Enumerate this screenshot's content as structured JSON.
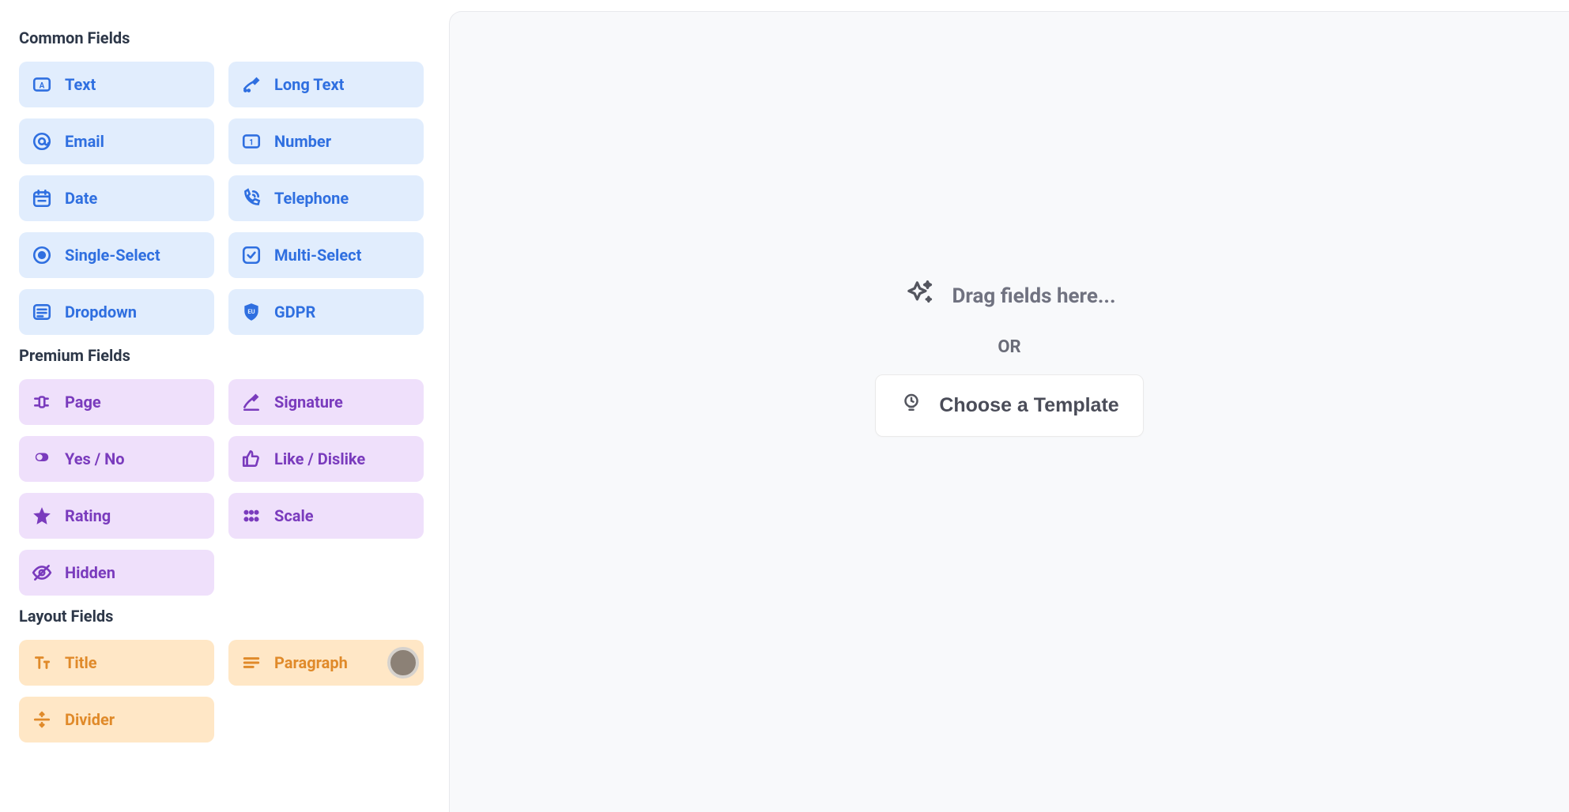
{
  "sections": {
    "common": {
      "title": "Common Fields",
      "items": [
        {
          "label": "Text",
          "icon": "text"
        },
        {
          "label": "Long Text",
          "icon": "longtext"
        },
        {
          "label": "Email",
          "icon": "email"
        },
        {
          "label": "Number",
          "icon": "number"
        },
        {
          "label": "Date",
          "icon": "date"
        },
        {
          "label": "Telephone",
          "icon": "phone"
        },
        {
          "label": "Single-Select",
          "icon": "radio"
        },
        {
          "label": "Multi-Select",
          "icon": "checkbox"
        },
        {
          "label": "Dropdown",
          "icon": "dropdown"
        },
        {
          "label": "GDPR",
          "icon": "gdpr"
        }
      ]
    },
    "premium": {
      "title": "Premium Fields",
      "items": [
        {
          "label": "Page",
          "icon": "page"
        },
        {
          "label": "Signature",
          "icon": "signature"
        },
        {
          "label": "Yes / No",
          "icon": "toggle"
        },
        {
          "label": "Like / Dislike",
          "icon": "thumb"
        },
        {
          "label": "Rating",
          "icon": "star"
        },
        {
          "label": "Scale",
          "icon": "scale"
        },
        {
          "label": "Hidden",
          "icon": "hidden"
        }
      ]
    },
    "layout": {
      "title": "Layout Fields",
      "items": [
        {
          "label": "Title",
          "icon": "title"
        },
        {
          "label": "Paragraph",
          "icon": "paragraph",
          "cursor": true
        },
        {
          "label": "Divider",
          "icon": "divider"
        }
      ]
    }
  },
  "canvas": {
    "drag_text": "Drag fields here...",
    "or_text": "OR",
    "template_button": "Choose a Template"
  },
  "colors": {
    "common": "#2f6fe0",
    "premium": "#7a3bbd",
    "layout": "#e08a2a"
  }
}
